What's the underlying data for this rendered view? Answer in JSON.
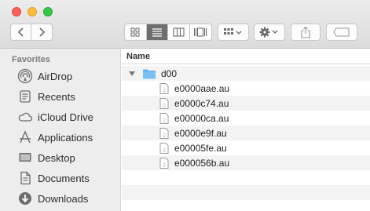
{
  "toolbar": {
    "back_icon": "chevron-left-icon",
    "forward_icon": "chevron-right-icon",
    "view_modes": [
      "icon-view",
      "list-view",
      "column-view",
      "gallery-view"
    ],
    "active_view": "list-view",
    "arrange_icon": "grid-arrange-icon",
    "action_icon": "gear-icon",
    "share_icon": "share-icon",
    "tag_icon": "tag-icon"
  },
  "sidebar": {
    "heading": "Favorites",
    "items": [
      {
        "label": "AirDrop",
        "icon": "airdrop-icon"
      },
      {
        "label": "Recents",
        "icon": "recents-icon"
      },
      {
        "label": "iCloud Drive",
        "icon": "cloud-icon"
      },
      {
        "label": "Applications",
        "icon": "applications-icon"
      },
      {
        "label": "Desktop",
        "icon": "desktop-icon"
      },
      {
        "label": "Documents",
        "icon": "documents-icon"
      },
      {
        "label": "Downloads",
        "icon": "downloads-icon"
      }
    ]
  },
  "file_list": {
    "column_name": "Name",
    "folder": {
      "name": "d00",
      "expanded": true
    },
    "files": [
      "e0000aae.au",
      "e0000c74.au",
      "e00000ca.au",
      "e0000e9f.au",
      "e00005fe.au",
      "e000056b.au"
    ]
  },
  "colors": {
    "folder_blue": "#5fb3ee",
    "active_segment": "#6e6e6e"
  }
}
